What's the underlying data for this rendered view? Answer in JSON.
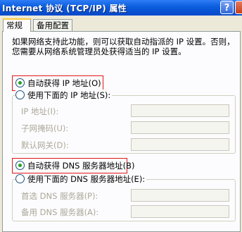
{
  "window": {
    "title": "Internet 协议 (TCP/IP) 属性",
    "help_label": "?"
  },
  "tabs": [
    {
      "label": "常规"
    },
    {
      "label": "备用配置"
    }
  ],
  "description": "如果网络支持此功能，则可以获取自动指派的 IP 设置。否则，您需要从网络系统管理员处获得适当的 IP 设置。",
  "ip_section": {
    "auto_option": {
      "label": "自动获得 IP 地址(O)",
      "selected": true
    },
    "manual_option": {
      "label": "使用下面的 IP 地址(S):",
      "selected": false
    },
    "fields": [
      {
        "label": "IP 地址(I):",
        "value": ""
      },
      {
        "label": "子网掩码(U):",
        "value": ""
      },
      {
        "label": "默认网关(D):",
        "value": ""
      }
    ]
  },
  "dns_section": {
    "auto_option": {
      "label": "自动获得 DNS 服务器地址(B)",
      "selected": true
    },
    "manual_option": {
      "label": "使用下面的 DNS 服务器地址(E):",
      "selected": false
    },
    "fields": [
      {
        "label": "首选 DNS 服务器(P):",
        "value": ""
      },
      {
        "label": "备用 DNS 服务器(A):",
        "value": ""
      }
    ]
  },
  "colors": {
    "title_bar": "#0a5ddd",
    "highlight_box": "#e01818",
    "dialog_bg": "#ece9d8",
    "panel_bg": "#fcfcfe"
  }
}
